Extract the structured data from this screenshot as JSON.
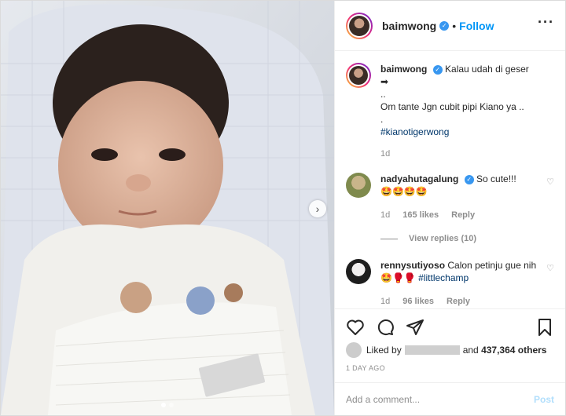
{
  "colors": {
    "accent": "#0095f6",
    "verified": "#3897f0",
    "hashtag": "#00376b",
    "muted": "#8e8e8e",
    "post_disabled": "#b2dffc"
  },
  "header": {
    "username": "baimwong",
    "bullet": "•",
    "follow_label": "Follow",
    "more_icon": "ellipsis-icon"
  },
  "caption": {
    "username": "baimwong",
    "line1": "Kalau udah di geser ➡",
    "line2": "..",
    "line3": "Om tante Jgn cubit pipi Kiano ya ..",
    "line4": ".",
    "hashtag": "#kianotigerwong",
    "time": "1d"
  },
  "comments": [
    {
      "username": "nadyahutagalung",
      "text": "So cute!!!",
      "emoji": "🤩🤩🤩🤩",
      "time": "1d",
      "likes": "165 likes",
      "reply": "Reply",
      "view_replies": "View replies (10)"
    },
    {
      "username": "rennysutiyoso",
      "text": "Calon petinju gue nih",
      "emoji": "🤩🥊🥊",
      "hashtag": "#littlechamp",
      "time": "1d",
      "likes": "96 likes",
      "reply": "Reply"
    }
  ],
  "likes": {
    "prefix": "Liked by",
    "suffix": "and",
    "count": "437,364 others"
  },
  "timestamp": "1 DAY AGO",
  "add_comment": {
    "placeholder": "Add a comment...",
    "post_label": "Post"
  },
  "carousel": {
    "next_icon": "chevron-right-icon",
    "slides": 2,
    "active": 1
  }
}
